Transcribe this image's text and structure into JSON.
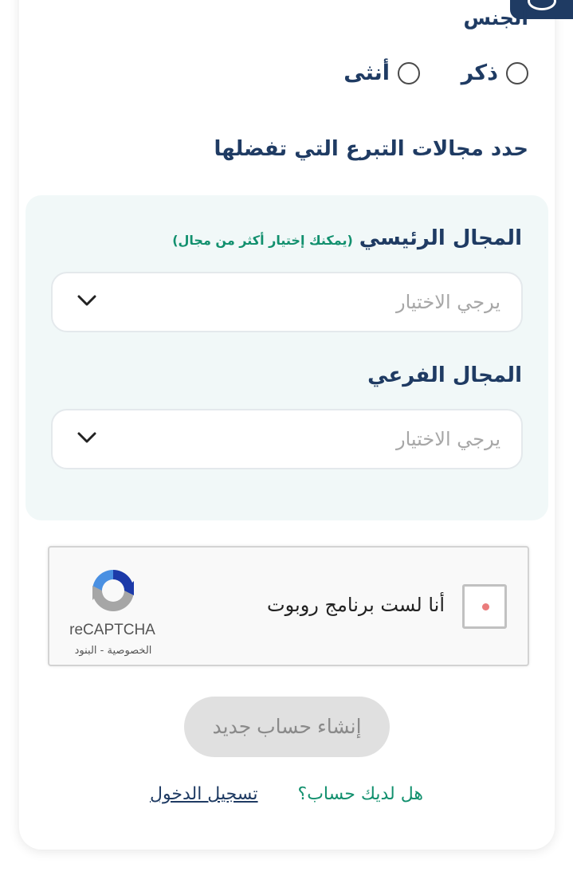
{
  "gender": {
    "label": "الجنس",
    "options": [
      {
        "label": "ذكر",
        "selected": false
      },
      {
        "label": "أنثى",
        "selected": false
      }
    ]
  },
  "donation": {
    "section_title": "حدد مجالات التبرع التي تفضلها",
    "main_field": {
      "label": "المجال الرئيسي",
      "hint": "(يمكنك إختيار أكثر من مجال)",
      "placeholder": "يرجي الاختيار"
    },
    "sub_field": {
      "label": "المجال الفرعي",
      "placeholder": "يرجي الاختيار"
    }
  },
  "recaptcha": {
    "checkbox_text": "أنا لست برنامج روبوت",
    "brand": "reCAPTCHA",
    "privacy": "الخصوصية",
    "separator": "-",
    "terms": "البنود",
    "checked": false
  },
  "actions": {
    "create_account": "إنشاء حساب جديد"
  },
  "footer": {
    "question": "هل لديك حساب؟",
    "login_link": "تسجيل الدخول"
  },
  "colors": {
    "primary": "#1f3b63",
    "accent": "#12906e",
    "panel_bg": "#f1f8f8",
    "disabled_button": "#e0e0e0"
  },
  "icons": {
    "chevron": "chevron-down-icon",
    "recaptcha_logo": "recaptcha-logo-icon"
  }
}
